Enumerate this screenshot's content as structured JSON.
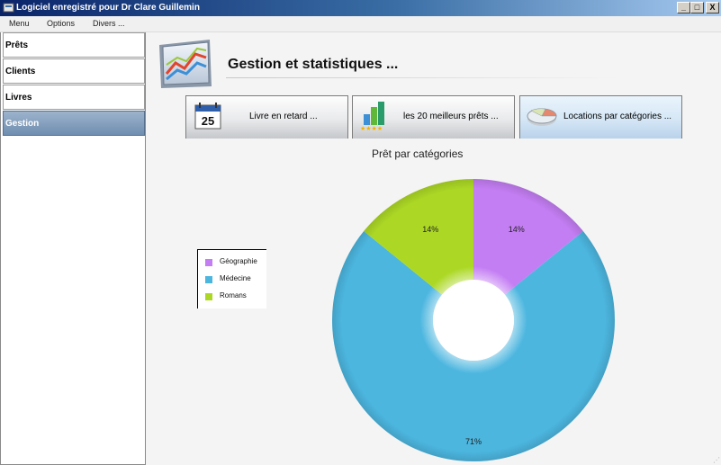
{
  "window": {
    "title": "Logiciel enregistré pour Dr Clare Guillemin",
    "min_label": "_",
    "max_label": "□",
    "close_label": "X"
  },
  "menu": {
    "items": [
      "Menu",
      "Options",
      "Divers ..."
    ]
  },
  "sidebar": {
    "items": [
      {
        "label": "Prêts",
        "active": false
      },
      {
        "label": "Clients",
        "active": false
      },
      {
        "label": "Livres",
        "active": false
      },
      {
        "label": "Gestion",
        "active": true
      }
    ]
  },
  "main": {
    "title": "Gestion et statistiques ...",
    "tabs": [
      {
        "label": "Livre en retard ...",
        "icon": "calendar-icon",
        "calendar_day": "25"
      },
      {
        "label": "les 20 meilleurs prêts ...",
        "icon": "bar-chart-stars-icon"
      },
      {
        "label": "Locations par catégories ...",
        "icon": "pie-chart-icon",
        "selected": true
      }
    ]
  },
  "colors": {
    "geographie": "#c47ef3",
    "medecine": "#4cb6df",
    "romans": "#acd825",
    "sidebar_active": "#7f9bbd"
  },
  "chart_data": {
    "type": "pie",
    "title": "Prêt par catégories",
    "donut": true,
    "legend_position": "left",
    "categories": [
      "Géographie",
      "Médecine",
      "Romans"
    ],
    "values": [
      14,
      71,
      14
    ],
    "value_labels": [
      "14%",
      "71%",
      "14%"
    ]
  }
}
